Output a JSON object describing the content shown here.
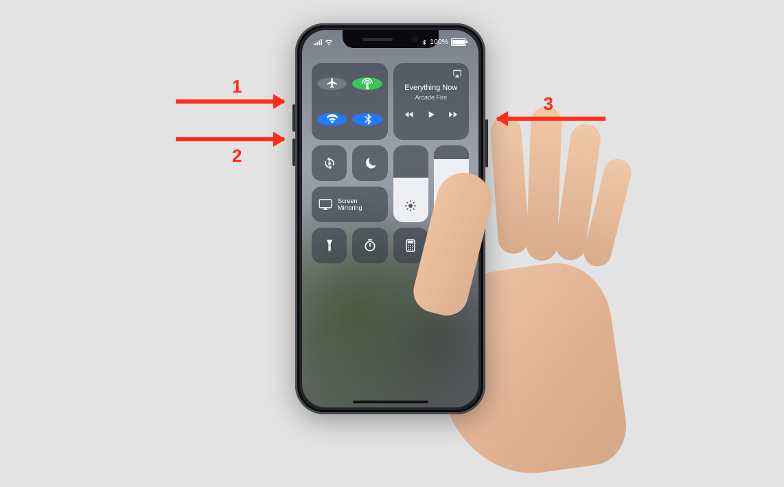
{
  "annotations": {
    "one": "1",
    "two": "2",
    "three": "3"
  },
  "status_bar": {
    "battery_text": "100%"
  },
  "control_center": {
    "now_playing": {
      "title": "Everything Now",
      "artist": "Arcade Fire"
    },
    "screen_mirroring_label": "Screen\nMirroring",
    "brightness_percent": 58,
    "volume_percent": 82
  },
  "colors": {
    "annotation": "#ff2c1a",
    "toggle_on_green": "#36c759",
    "toggle_on_blue": "#1f7bff"
  }
}
